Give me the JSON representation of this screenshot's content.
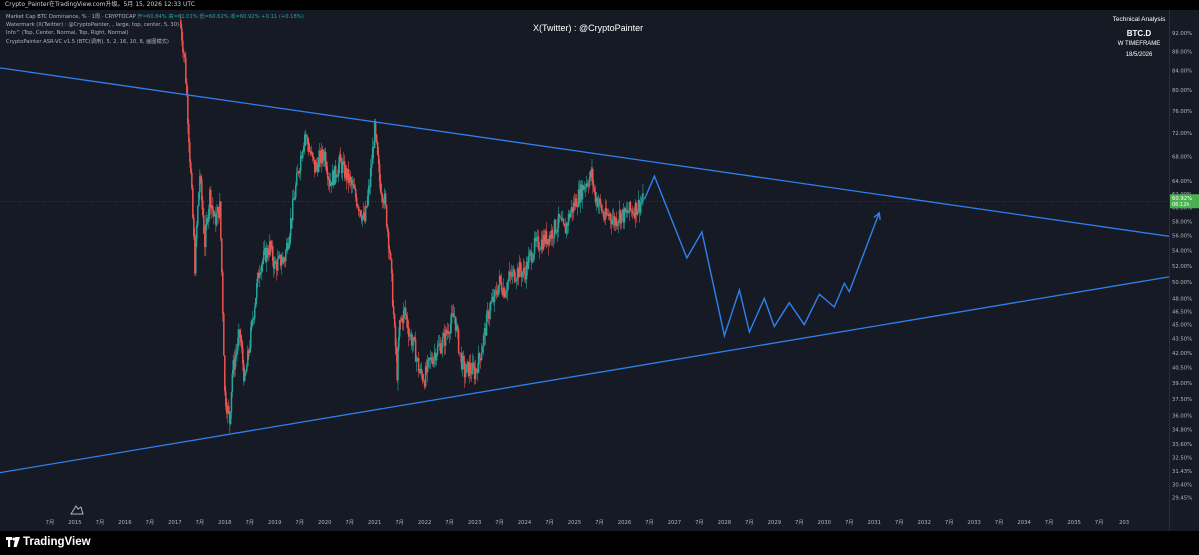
{
  "header": {
    "text": "Crypto_Painter在TradingView.com升级。5月 15, 2026 12:33 UTC"
  },
  "legend": {
    "symbol_line": {
      "prefix": "Market Cap BTC Dominance, % · 1周 · CRYPTOCAP",
      "open": "开=60.84%",
      "high": "高=61.01%",
      "low": "低=60.62%",
      "close": "收=60.92% +0.11 (+0.18%)"
    },
    "lines": [
      "Watermark (X(Twitter) : @CryptoPainter, , large, top, center, 5, 30)",
      "Info^ (Top, Center, Normal, Top, Right, Normal)",
      "CryptoPainter ASR-VC v1.5 (BTC(调用), 5, 2, 16, 10, 8, 画图模式)"
    ]
  },
  "watermark": "X(Twitter) : @CryptoPainter",
  "analysis": {
    "line1": "Technical Analysis",
    "line2": "BTC.D",
    "line3": "W TIMEFRAME",
    "line4": "18/5/2026"
  },
  "footer": {
    "brand": "TradingView"
  },
  "colors": {
    "background": "#161a25",
    "trendline": "#2f80ed",
    "bull": "#26a69a",
    "bear": "#ef5350",
    "price_label": "#4caf50",
    "axis_text": "#b2b5be"
  },
  "chart_data": {
    "type": "candlestick",
    "y_axis": {
      "scale": "log",
      "ylim": [
        27.8,
        95.5
      ],
      "tick_labels": [
        "29.45%",
        "30.40%",
        "31.43%",
        "32.50%",
        "33.60%",
        "34.80%",
        "36.00%",
        "37.50%",
        "39.00%",
        "40.50%",
        "42.00%",
        "43.50%",
        "45.00%",
        "46.50%",
        "48.00%",
        "50.00%",
        "52.00%",
        "54.00%",
        "56.00%",
        "58.00%",
        "60.00%",
        "62.00%",
        "64.00%",
        "68.00%",
        "72.00%",
        "76.00%",
        "80.00%",
        "84.00%",
        "88.00%",
        "92.00%"
      ]
    },
    "x_axis": {
      "range": [
        2013.5,
        2036.9
      ],
      "tick_labels": [
        {
          "label": "7月",
          "x": 2014.5
        },
        {
          "label": "2015",
          "x": 2015.0
        },
        {
          "label": "7月",
          "x": 2015.5
        },
        {
          "label": "2016",
          "x": 2016.0
        },
        {
          "label": "7月",
          "x": 2016.5
        },
        {
          "label": "2017",
          "x": 2017.0
        },
        {
          "label": "7月",
          "x": 2017.5
        },
        {
          "label": "2018",
          "x": 2018.0
        },
        {
          "label": "7月",
          "x": 2018.5
        },
        {
          "label": "2019",
          "x": 2019.0
        },
        {
          "label": "7月",
          "x": 2019.5
        },
        {
          "label": "2020",
          "x": 2020.0
        },
        {
          "label": "7月",
          "x": 2020.5
        },
        {
          "label": "2021",
          "x": 2021.0
        },
        {
          "label": "7月",
          "x": 2021.5
        },
        {
          "label": "2022",
          "x": 2022.0
        },
        {
          "label": "7月",
          "x": 2022.5
        },
        {
          "label": "2023",
          "x": 2023.0
        },
        {
          "label": "7月",
          "x": 2023.5
        },
        {
          "label": "2024",
          "x": 2024.0
        },
        {
          "label": "7月",
          "x": 2024.5
        },
        {
          "label": "2025",
          "x": 2025.0
        },
        {
          "label": "7月",
          "x": 2025.5
        },
        {
          "label": "2026",
          "x": 2026.0
        },
        {
          "label": "7月",
          "x": 2026.5
        },
        {
          "label": "2027",
          "x": 2027.0
        },
        {
          "label": "7月",
          "x": 2027.5
        },
        {
          "label": "2028",
          "x": 2028.0
        },
        {
          "label": "7月",
          "x": 2028.5
        },
        {
          "label": "2029",
          "x": 2029.0
        },
        {
          "label": "7月",
          "x": 2029.5
        },
        {
          "label": "2030",
          "x": 2030.0
        },
        {
          "label": "7月",
          "x": 2030.5
        },
        {
          "label": "2031",
          "x": 2031.0
        },
        {
          "label": "7月",
          "x": 2031.5
        },
        {
          "label": "2032",
          "x": 2032.0
        },
        {
          "label": "7月",
          "x": 2032.5
        },
        {
          "label": "2033",
          "x": 2033.0
        },
        {
          "label": "7月",
          "x": 2033.5
        },
        {
          "label": "2034",
          "x": 2034.0
        },
        {
          "label": "7月",
          "x": 2034.5
        },
        {
          "label": "2035",
          "x": 2035.0
        },
        {
          "label": "7月",
          "x": 2035.5
        },
        {
          "label": "203",
          "x": 2036.0
        }
      ]
    },
    "current_price": {
      "value": 60.92,
      "label": "60.92%",
      "sublabel": "06:12h",
      "color": "#4caf50"
    },
    "price_path": [
      [
        2017.1,
        95.0
      ],
      [
        2017.2,
        86.0
      ],
      [
        2017.3,
        68.0
      ],
      [
        2017.4,
        52.0
      ],
      [
        2017.5,
        65.0
      ],
      [
        2017.6,
        55.0
      ],
      [
        2017.7,
        62.0
      ],
      [
        2017.8,
        58.0
      ],
      [
        2017.9,
        60.0
      ],
      [
        2018.0,
        38.0
      ],
      [
        2018.1,
        35.5
      ],
      [
        2018.15,
        40.0
      ],
      [
        2018.3,
        44.0
      ],
      [
        2018.4,
        39.0
      ],
      [
        2018.5,
        43.0
      ],
      [
        2018.7,
        52.0
      ],
      [
        2018.9,
        54.5
      ],
      [
        2019.0,
        52.0
      ],
      [
        2019.2,
        53.0
      ],
      [
        2019.3,
        57.0
      ],
      [
        2019.4,
        62.0
      ],
      [
        2019.5,
        67.0
      ],
      [
        2019.6,
        72.0
      ],
      [
        2019.7,
        69.0
      ],
      [
        2019.8,
        66.0
      ],
      [
        2019.9,
        67.5
      ],
      [
        2020.0,
        68.5
      ],
      [
        2020.1,
        64.0
      ],
      [
        2020.2,
        65.0
      ],
      [
        2020.3,
        67.0
      ],
      [
        2020.5,
        64.0
      ],
      [
        2020.6,
        62.0
      ],
      [
        2020.7,
        60.0
      ],
      [
        2020.8,
        58.0
      ],
      [
        2020.9,
        63.5
      ],
      [
        2021.0,
        72.5
      ],
      [
        2021.1,
        64.0
      ],
      [
        2021.2,
        61.0
      ],
      [
        2021.3,
        54.0
      ],
      [
        2021.4,
        44.0
      ],
      [
        2021.45,
        40.0
      ],
      [
        2021.5,
        45.0
      ],
      [
        2021.6,
        46.5
      ],
      [
        2021.7,
        44.0
      ],
      [
        2021.8,
        42.5
      ],
      [
        2021.9,
        40.0
      ],
      [
        2022.0,
        39.5
      ],
      [
        2022.1,
        41.0
      ],
      [
        2022.2,
        42.0
      ],
      [
        2022.4,
        43.5
      ],
      [
        2022.5,
        45.0
      ],
      [
        2022.6,
        46.0
      ],
      [
        2022.7,
        42.0
      ],
      [
        2022.8,
        40.0
      ],
      [
        2022.9,
        40.5
      ],
      [
        2023.0,
        40.0
      ],
      [
        2023.1,
        41.5
      ],
      [
        2023.2,
        44.0
      ],
      [
        2023.3,
        47.0
      ],
      [
        2023.4,
        48.0
      ],
      [
        2023.5,
        50.0
      ],
      [
        2023.6,
        49.0
      ],
      [
        2023.7,
        50.5
      ],
      [
        2023.8,
        51.0
      ],
      [
        2023.9,
        51.5
      ],
      [
        2024.0,
        51.0
      ],
      [
        2024.1,
        53.0
      ],
      [
        2024.2,
        54.5
      ],
      [
        2024.3,
        55.0
      ],
      [
        2024.4,
        55.5
      ],
      [
        2024.5,
        56.0
      ],
      [
        2024.6,
        57.0
      ],
      [
        2024.7,
        58.0
      ],
      [
        2024.8,
        56.5
      ],
      [
        2024.9,
        59.0
      ],
      [
        2025.0,
        60.5
      ],
      [
        2025.1,
        62.0
      ],
      [
        2025.2,
        63.5
      ],
      [
        2025.3,
        64.5
      ],
      [
        2025.35,
        65.0
      ],
      [
        2025.4,
        62.0
      ],
      [
        2025.5,
        60.5
      ],
      [
        2025.6,
        58.5
      ],
      [
        2025.7,
        59.0
      ],
      [
        2025.8,
        58.0
      ],
      [
        2025.9,
        59.0
      ],
      [
        2026.0,
        58.8
      ],
      [
        2026.1,
        59.5
      ],
      [
        2026.2,
        59.8
      ],
      [
        2026.3,
        60.5
      ],
      [
        2026.37,
        60.92
      ]
    ],
    "trendlines": [
      {
        "name": "upper",
        "points": [
          [
            2013.5,
            84.5
          ],
          [
            2036.9,
            55.9
          ]
        ]
      },
      {
        "name": "lower",
        "points": [
          [
            2013.5,
            31.3
          ],
          [
            2036.9,
            50.6
          ]
        ]
      }
    ],
    "projection_path": [
      [
        2026.4,
        61.2
      ],
      [
        2026.6,
        64.8
      ],
      [
        2027.25,
        53.0
      ],
      [
        2027.55,
        56.5
      ],
      [
        2028.0,
        43.8
      ],
      [
        2028.3,
        49.0
      ],
      [
        2028.5,
        44.2
      ],
      [
        2028.8,
        48.0
      ],
      [
        2029.0,
        44.8
      ],
      [
        2029.3,
        47.5
      ],
      [
        2029.6,
        45.0
      ],
      [
        2029.9,
        48.5
      ],
      [
        2030.2,
        47.0
      ],
      [
        2030.4,
        49.8
      ],
      [
        2030.5,
        48.8
      ],
      [
        2031.1,
        59.2
      ]
    ],
    "annotations": []
  }
}
